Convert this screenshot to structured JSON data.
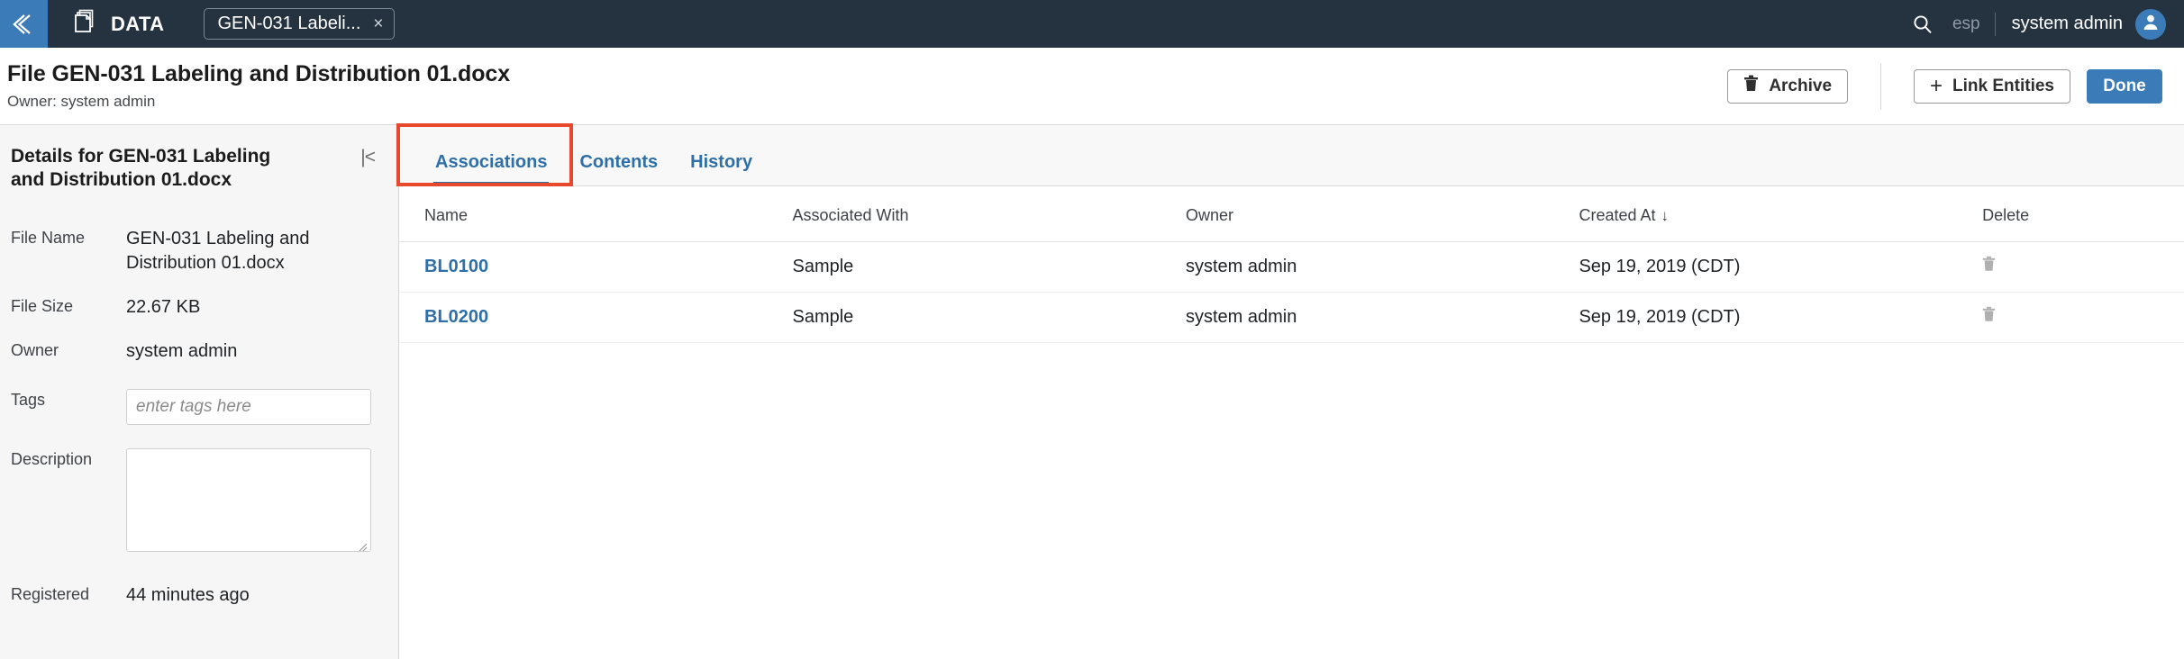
{
  "topnav": {
    "back_icon": "chevron-left-icon",
    "brand_icon": "copy-documents-icon",
    "brand_label": "DATA",
    "tab_pill": {
      "label": "GEN-031 Labeli...",
      "close": "×"
    },
    "search_icon": "search-icon",
    "language": "esp",
    "user_name": "system admin",
    "avatar_icon": "user-avatar-icon",
    "accent_blue": "#3b7cb8",
    "bar_bg": "#253340"
  },
  "titlebar": {
    "title": "File GEN-031 Labeling and Distribution 01.docx",
    "subtitle": "Owner: system admin",
    "archive_label": "Archive",
    "archive_icon": "trash-icon",
    "link_entities_label": "Link Entities",
    "link_entities_icon": "plus-icon",
    "done_label": "Done"
  },
  "details": {
    "panel_title": "Details for GEN-031 Labeling and Distribution 01.docx",
    "collapse_icon": "collapse-panel-icon",
    "fields": [
      {
        "label": "File Name",
        "value": "GEN-031 Labeling and Distribution 01.docx"
      },
      {
        "label": "File Size",
        "value": "22.67 KB"
      },
      {
        "label": "Owner",
        "value": "system admin"
      }
    ],
    "tags": {
      "label": "Tags",
      "value": "",
      "placeholder": "enter tags here"
    },
    "description": {
      "label": "Description",
      "value": "",
      "placeholder": ""
    },
    "registered": {
      "label": "Registered",
      "value": "44 minutes ago"
    }
  },
  "tabs": {
    "items": [
      {
        "label": "Associations",
        "active": true
      },
      {
        "label": "Contents",
        "active": false
      },
      {
        "label": "History",
        "active": false
      }
    ],
    "highlight_color": "#e8482b"
  },
  "table": {
    "columns": [
      "Name",
      "Associated With",
      "Owner",
      "Created At",
      "Delete"
    ],
    "sort_column": "Created At",
    "sort_direction_glyph": "↓",
    "rows": [
      {
        "name": "BL0100",
        "associated_with": "Sample",
        "owner": "system admin",
        "created_at": "Sep 19, 2019 (CDT)",
        "delete_icon": "trash-icon"
      },
      {
        "name": "BL0200",
        "associated_with": "Sample",
        "owner": "system admin",
        "created_at": "Sep 19, 2019 (CDT)",
        "delete_icon": "trash-icon"
      }
    ]
  }
}
